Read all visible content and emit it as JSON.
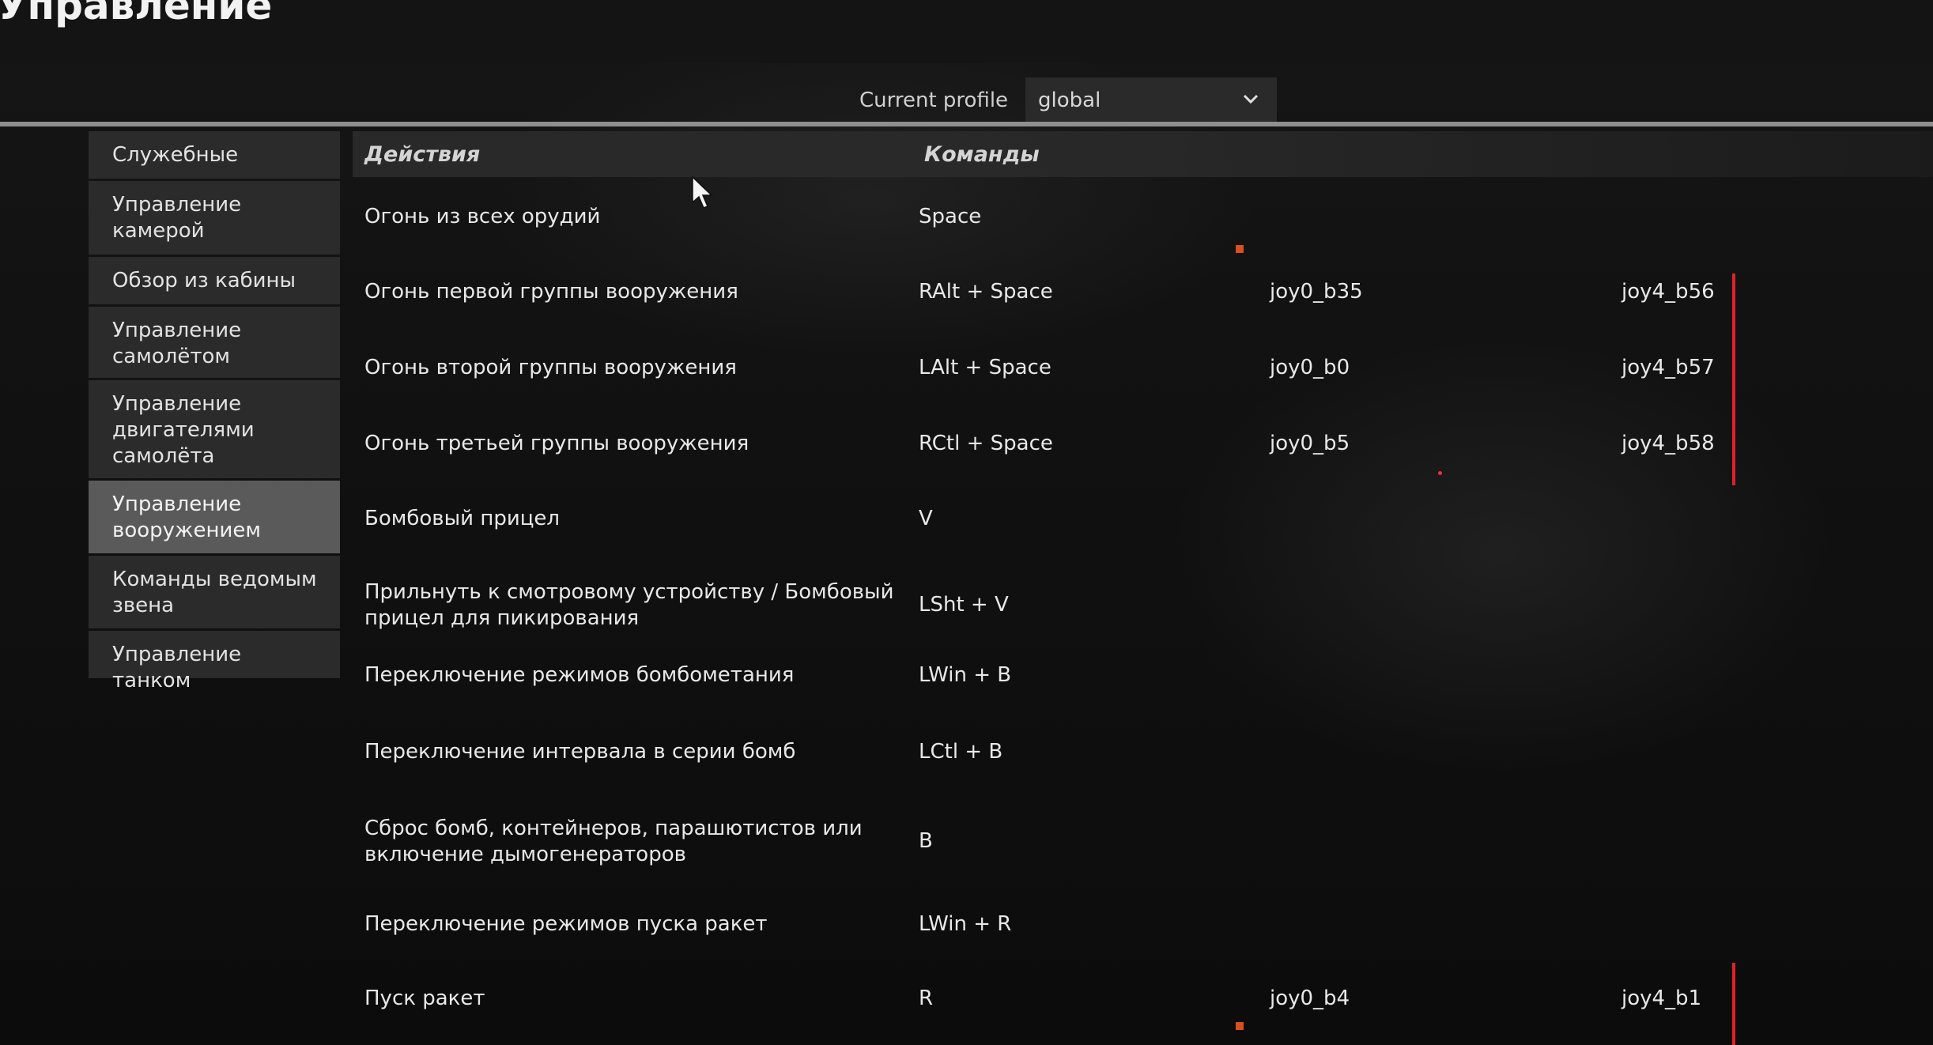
{
  "page": {
    "title": "Управление"
  },
  "profile": {
    "label": "Current profile",
    "value": "global"
  },
  "sidebar": {
    "items": [
      {
        "label": "Служебные",
        "active": false
      },
      {
        "label": "Управление камерой",
        "active": false
      },
      {
        "label": "Обзор из кабины",
        "active": false
      },
      {
        "label": "Управление самолётом",
        "active": false
      },
      {
        "label": "Управление двигателями самолёта",
        "active": false
      },
      {
        "label": "Управление вооружением",
        "active": true
      },
      {
        "label": "Команды ведомым звена",
        "active": false
      },
      {
        "label": "Управление танком",
        "active": false
      }
    ]
  },
  "table": {
    "headers": {
      "actions": "Действия",
      "commands": "Команды"
    },
    "rows": [
      {
        "action": "Огонь из всех орудий",
        "cmd": "Space",
        "joy0": "",
        "joy4": ""
      },
      {
        "action": "Огонь первой группы вооружения",
        "cmd": "RAlt + Space",
        "joy0": "joy0_b35",
        "joy4": "joy4_b56"
      },
      {
        "action": "Огонь второй группы вооружения",
        "cmd": "LAlt + Space",
        "joy0": "joy0_b0",
        "joy4": "joy4_b57"
      },
      {
        "action": "Огонь третьей группы вооружения",
        "cmd": "RCtl + Space",
        "joy0": "joy0_b5",
        "joy4": "joy4_b58"
      },
      {
        "action": "Бомбовый прицел",
        "cmd": "V",
        "joy0": "",
        "joy4": ""
      },
      {
        "action": "Прильнуть к смотровому устройству / Бомбовый\nприцел для пикирования",
        "cmd": "LSht + V",
        "joy0": "",
        "joy4": ""
      },
      {
        "action": "Переключение режимов бомбометания",
        "cmd": "LWin + B",
        "joy0": "",
        "joy4": ""
      },
      {
        "action": "Переключение интервала в серии бомб",
        "cmd": "LCtl + B",
        "joy0": "",
        "joy4": ""
      },
      {
        "action": "Сброс бомб, контейнеров, парашютистов или\nвключение дымогенераторов",
        "cmd": "B",
        "joy0": "",
        "joy4": ""
      },
      {
        "action": "Переключение режимов пуска ракет",
        "cmd": "LWin + R",
        "joy0": "",
        "joy4": ""
      },
      {
        "action": "Пуск ракет",
        "cmd": "R",
        "joy0": "joy0_b4",
        "joy4": "joy4_b1"
      }
    ]
  },
  "colors": {
    "conflict": "#e0202a",
    "marker": "#d8501e",
    "sidebar_active": "#5a5a5a",
    "sidebar_item": "#2b2b2b"
  },
  "icons": {
    "dropdown": "chevron-down-icon",
    "cursor": "mouse-cursor-icon"
  }
}
